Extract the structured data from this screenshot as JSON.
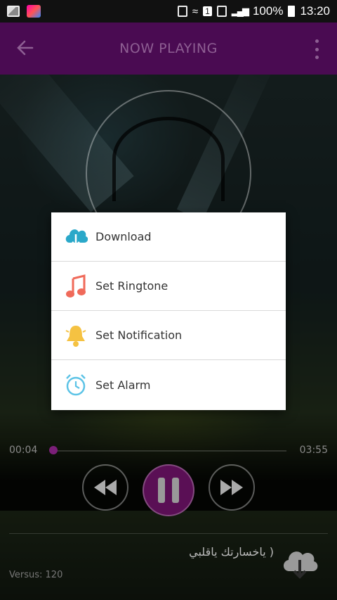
{
  "status_bar": {
    "battery": "100%",
    "time": "13:20",
    "sim_badge": "1"
  },
  "app_bar": {
    "title": "NOW PLAYING"
  },
  "player": {
    "current_time": "00:04",
    "total_time": "03:55",
    "progress": 0.017,
    "song_title": "( ياخسارتك ياقلبي",
    "version": "Versus: 120"
  },
  "dialog": {
    "items": [
      {
        "label": "Download",
        "icon": "cloud-download-icon"
      },
      {
        "label": "Set Ringtone",
        "icon": "music-note-icon"
      },
      {
        "label": "Set Notification",
        "icon": "bell-icon"
      },
      {
        "label": "Set Alarm",
        "icon": "alarm-clock-icon"
      }
    ]
  },
  "colors": {
    "app_bar": "#4a0b52",
    "accent": "#7b1f78",
    "download_icon": "#2aa8c9",
    "ringtone_icon": "#f06a5a",
    "notification_icon": "#f5c242",
    "alarm_icon": "#5cc3e6"
  }
}
